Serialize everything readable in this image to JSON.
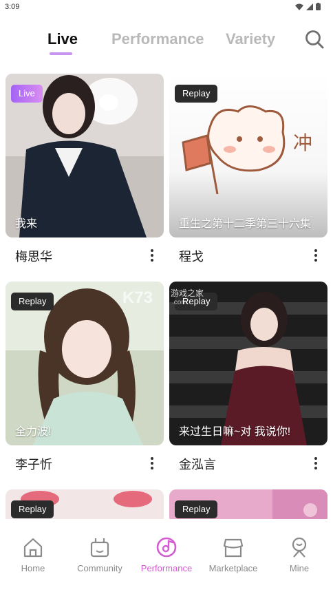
{
  "status_bar": {
    "time": "3:09"
  },
  "header": {
    "tabs": [
      {
        "label": "Live",
        "active": true
      },
      {
        "label": "Performance",
        "active": false
      },
      {
        "label": "Variety",
        "active": false
      }
    ]
  },
  "cards": [
    {
      "badge": "Live",
      "caption": "我来",
      "name": "梅思华"
    },
    {
      "badge": "Replay",
      "caption": "重生之第十二季第三十六集",
      "name": "程戈",
      "art_text": "冲"
    },
    {
      "badge": "Replay",
      "caption": "全力波!",
      "name": "李子忻"
    },
    {
      "badge": "Replay",
      "caption": "来过生日嘛~对 我说你!",
      "name": "金泓言",
      "watermark": "K73 游戏之家 .com"
    },
    {
      "badge": "Replay"
    },
    {
      "badge": "Replay"
    }
  ],
  "bottom_nav": {
    "items": [
      {
        "label": "Home",
        "icon": "home-icon"
      },
      {
        "label": "Community",
        "icon": "community-icon"
      },
      {
        "label": "Performance",
        "icon": "performance-icon",
        "active": true
      },
      {
        "label": "Marketplace",
        "icon": "marketplace-icon"
      },
      {
        "label": "Mine",
        "icon": "mine-icon"
      }
    ]
  },
  "colors": {
    "accent": "#c795f0",
    "active_nav": "#d45cd2",
    "live_badge": "#b070f5",
    "replay_badge": "#2b2b2b"
  }
}
